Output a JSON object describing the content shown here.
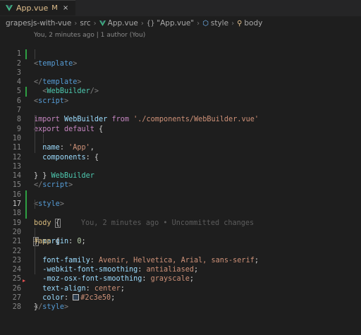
{
  "tab": {
    "filename": "App.vue",
    "modified_flag": "M",
    "close_glyph": "×",
    "icon": "vue-icon"
  },
  "breadcrumb": {
    "items": [
      "grapesjs-with-vue",
      "src",
      "App.vue",
      "\"App.vue\"",
      "style",
      "body"
    ],
    "separator": "›"
  },
  "codelens": "You, 2 minutes ago | 1 author (You)",
  "blame_inline": "You, 2 minutes ago • Uncommitted changes",
  "colors": {
    "tag": "#569cd6",
    "component": "#4ec9b0",
    "keyword": "#c586c0",
    "string": "#ce9178",
    "property": "#9cdcfe",
    "selector": "#d7ba7d",
    "number": "#b5cea8",
    "swatch": "#2c3e50",
    "change_bar": "#2ea043"
  },
  "code": {
    "line_numbers": [
      "1",
      "2",
      "3",
      "4",
      "5",
      "6",
      "7",
      "8",
      "9",
      "10",
      "11",
      "12",
      "13",
      "14",
      "15",
      "16",
      "17",
      "18",
      "19",
      "20",
      "21",
      "22",
      "23",
      "24",
      "25",
      "26",
      "27",
      "28"
    ],
    "l1": {
      "open": "<",
      "tag": "template",
      "close": ">"
    },
    "l2": {
      "open": "<",
      "comp": "WebBuilder",
      "close": "/>"
    },
    "l3": {
      "open": "</",
      "tag": "template",
      "close": ">"
    },
    "l5": {
      "open": "<",
      "tag": "script",
      "close": ">"
    },
    "l6": {
      "kw": "import",
      "name": "WebBuilder",
      "from": "from",
      "path": "'./components/WebBuilder.vue'"
    },
    "l8": {
      "kw": "export",
      "kw2": "default",
      "brace": "{"
    },
    "l9": {
      "prop": "name",
      "colon": ":",
      "val": "'App'",
      "comma": ","
    },
    "l10": {
      "prop": "components",
      "colon": ":",
      "brace": "{"
    },
    "l11": {
      "comp": "WebBuilder"
    },
    "l12": {
      "brace": "}"
    },
    "l13": {
      "brace": "}"
    },
    "l14": {
      "open": "</",
      "tag": "script",
      "close": ">"
    },
    "l16": {
      "open": "<",
      "tag": "style",
      "close": ">"
    },
    "l17": {
      "sel": "body",
      "brace": "{"
    },
    "l18": {
      "prop": "margin",
      "colon": ":",
      "val": "0",
      "semi": ";"
    },
    "l19": {
      "brace": "}"
    },
    "l20": {
      "sel": "#app",
      "brace": "{"
    },
    "l21": {
      "prop": "font-family",
      "colon": ":",
      "val": "Avenir, Helvetica, Arial, sans-serif",
      "semi": ";"
    },
    "l22": {
      "prop": "-webkit-font-smoothing",
      "colon": ":",
      "val": "antialiased",
      "semi": ";"
    },
    "l23": {
      "prop": "-moz-osx-font-smoothing",
      "colon": ":",
      "val": "grayscale",
      "semi": ";"
    },
    "l24": {
      "prop": "text-align",
      "colon": ":",
      "val": "center",
      "semi": ";"
    },
    "l25": {
      "prop": "color",
      "colon": ":",
      "val": "#2c3e50",
      "semi": ";"
    },
    "l26": {
      "brace": "}"
    },
    "l27": {
      "open": "</",
      "tag": "style",
      "close": ">"
    }
  }
}
